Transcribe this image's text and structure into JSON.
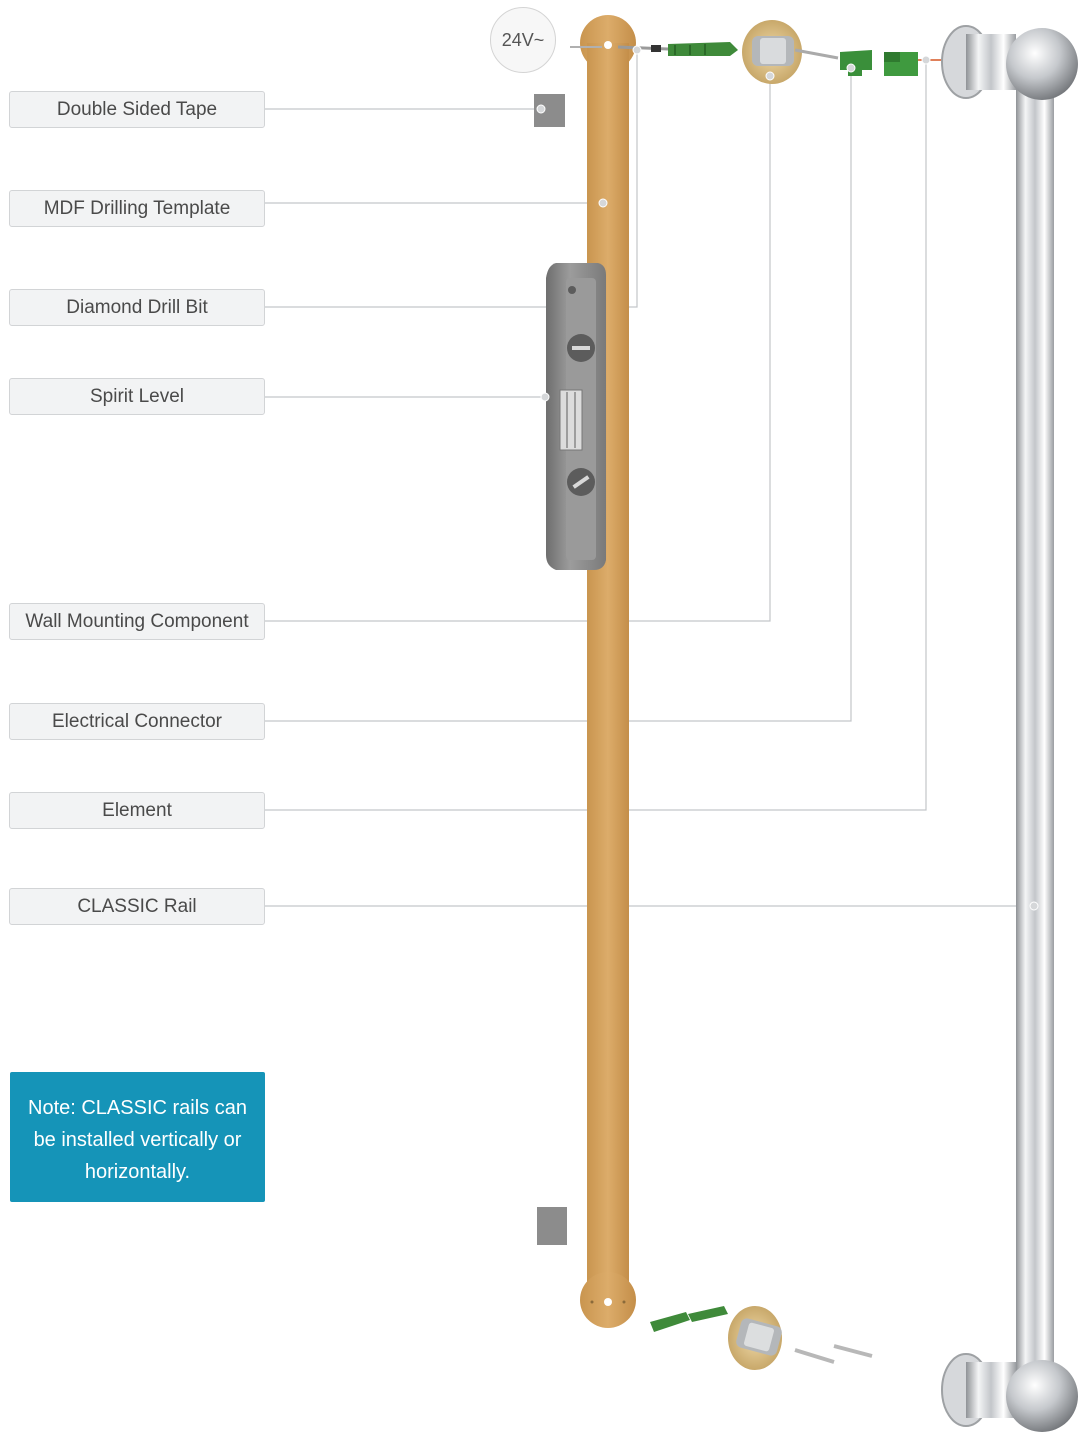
{
  "voltage_badge": "24V~",
  "labels": [
    {
      "id": "double-sided-tape",
      "text": "Double Sided Tape"
    },
    {
      "id": "mdf-drilling-template",
      "text": "MDF Drilling Template"
    },
    {
      "id": "diamond-drill-bit",
      "text": "Diamond Drill Bit"
    },
    {
      "id": "spirit-level",
      "text": "Spirit Level"
    },
    {
      "id": "wall-mounting-component",
      "text": "Wall Mounting Component"
    },
    {
      "id": "electrical-connector",
      "text": "Electrical Connector"
    },
    {
      "id": "element",
      "text": "Element"
    },
    {
      "id": "classic-rail",
      "text": "CLASSIC Rail"
    }
  ],
  "note": "Note: CLASSIC rails can be installed vertically or horizontally.",
  "colors": {
    "template": "#d4a35f",
    "connector_green": "#3f8a3a",
    "note_bg": "#1594b8",
    "chrome": "#c8cbcf",
    "level_grey": "#8d8d8d"
  }
}
